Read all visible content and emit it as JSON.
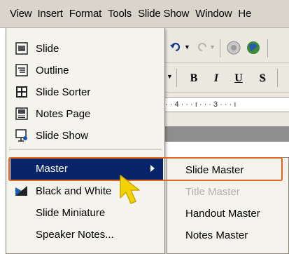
{
  "menubar": {
    "items": [
      {
        "label": "View",
        "ul": "V"
      },
      {
        "label": "Insert",
        "ul": "I"
      },
      {
        "label": "Format",
        "ul": "o"
      },
      {
        "label": "Tools",
        "ul": "T"
      },
      {
        "label": "Slide Show",
        "ul": "d"
      },
      {
        "label": "Window",
        "ul": "W"
      },
      {
        "label": "He",
        "ul": "H"
      }
    ]
  },
  "toolbar": {
    "bold": "B",
    "italic": "I",
    "underline": "U",
    "shadow": "S",
    "ruler_text": "· · 4 · · · ı · · · 3 · · · ı"
  },
  "view_menu": {
    "items": [
      {
        "label": "Slide",
        "icon": "slide-view-icon"
      },
      {
        "label": "Outline",
        "icon": "outline-view-icon"
      },
      {
        "label": "Slide Sorter",
        "icon": "slide-sorter-icon"
      },
      {
        "label": "Notes Page",
        "icon": "notes-page-icon"
      },
      {
        "label": "Slide Show",
        "icon": "slide-show-icon"
      },
      {
        "label": "Master",
        "icon": ""
      },
      {
        "label": "Black and White",
        "icon": "black-and-white-icon"
      },
      {
        "label": "Slide Miniature",
        "icon": ""
      },
      {
        "label": "Speaker Notes...",
        "icon": ""
      }
    ]
  },
  "master_submenu": {
    "items": [
      {
        "label": "Slide Master",
        "enabled": true
      },
      {
        "label": "Title Master",
        "enabled": false
      },
      {
        "label": "Handout Master",
        "enabled": true
      },
      {
        "label": "Notes Master",
        "enabled": true
      }
    ]
  },
  "colors": {
    "highlight": "#0a246a",
    "callout_border": "#e0651a",
    "cursor": "#f2d200"
  }
}
